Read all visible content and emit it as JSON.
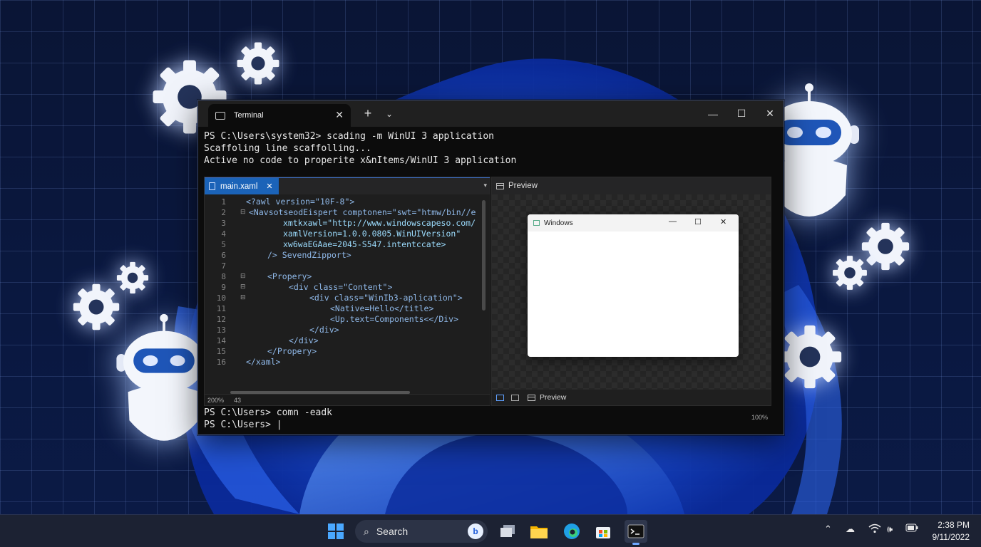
{
  "terminal": {
    "tab_title": "Terminal",
    "new_tab": "+",
    "dropdown": "⌄",
    "close_tab": "✕",
    "window_controls": {
      "minimize": "—",
      "maximize": "☐",
      "close": "✕"
    },
    "lines": [
      "PS C:\\Users\\system32> scading -m WinUI 3 application",
      "Scaffoling line scaffolling...",
      "Active no code to properite x&nItems/WinUI 3 application"
    ],
    "bottom_lines": [
      "PS C:\\Users> comn -eadk",
      "PS C:\\Users> |"
    ]
  },
  "editor": {
    "tab_label": "main.xaml",
    "tab_close": "✕",
    "line_numbers": [
      "1",
      "2",
      "3",
      "4",
      "5",
      "6",
      "7",
      "8",
      "9",
      "10",
      "11",
      "12",
      "13",
      "14",
      "15",
      "16"
    ],
    "code_lines": [
      "<?awl version=\"10F-8\">",
      "<NavsotseodEispert comptonen=\"swt=\"htmw/bin//e",
      "xmtkxawl=\"http://www.windowscapeso.com/",
      "xamlVersion=1.0.0.0805.WinUIVersion\"",
      "xw6waEGAae=2045-S547.intentccate>",
      "/> SevendZipport>",
      "",
      "<Propery>",
      "<div class=\"Content\">",
      "<div class=\"WinIb3-aplication\">",
      "<Native=Hello</title>",
      "<Up.text=Components<</Div>",
      "</div>",
      "</div>",
      "</Propery>",
      "</xaml>"
    ],
    "status_zoom": "200%",
    "status_extra": "43"
  },
  "preview": {
    "title": "Preview",
    "mini_window_title": "Windows",
    "mini_controls": {
      "minimize": "—",
      "maximize": "☐",
      "close": "✕"
    },
    "footer_label": "Preview",
    "zoom": "100%"
  },
  "taskbar": {
    "search_placeholder": "Search",
    "bing_label": "b",
    "clock_time": "2:38 PM",
    "clock_date": "9/11/2022",
    "apps": [
      "start-icon",
      "task-view-icon",
      "file-explorer-icon",
      "edge-icon",
      "store-icon",
      "terminal-icon"
    ],
    "tray_icons": [
      "chevron-up-icon",
      "cloud-icon",
      "wifi-icon",
      "volume-icon",
      "battery-icon"
    ]
  },
  "colors": {
    "accent": "#1b63b8",
    "desktop_bg": "#0a1535",
    "bloom": "#2a5ff0",
    "terminal_bg": "#0c0c0c"
  }
}
